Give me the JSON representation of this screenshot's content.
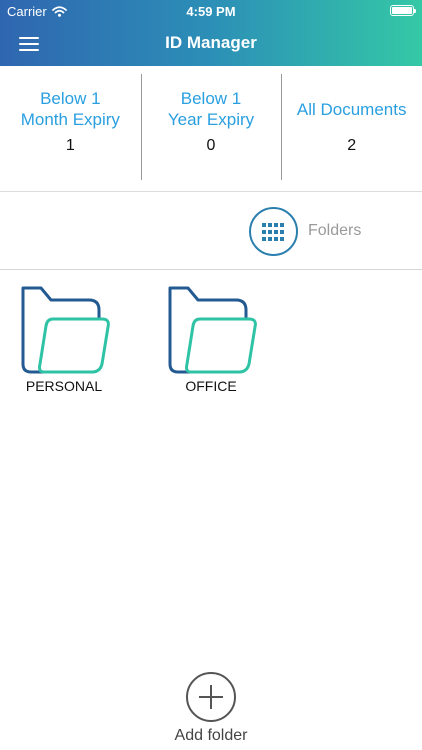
{
  "status_bar": {
    "carrier": "Carrier",
    "time": "4:59 PM"
  },
  "header": {
    "title": "ID Manager",
    "menu_icon": "hamburger-menu-icon"
  },
  "stats": [
    {
      "label_line1": "Below 1",
      "label_line2": "Month Expiry",
      "count": "1"
    },
    {
      "label_line1": "Below 1",
      "label_line2": "Year Expiry",
      "count": "0"
    },
    {
      "label": "All Documents",
      "count": "2"
    }
  ],
  "view_toggle": {
    "label": "Folders",
    "icon": "grid-icon"
  },
  "folders": [
    {
      "name": "PERSONAL",
      "icon": "folder-icon"
    },
    {
      "name": "OFFICE",
      "icon": "folder-icon"
    }
  ],
  "add_folder": {
    "label": "Add folder",
    "icon": "plus-icon"
  },
  "colors": {
    "header_gradient": [
      "#2f66b0",
      "#34c8a6"
    ],
    "stat_label": "#2a9fe0",
    "folder_back": "#235a91",
    "folder_front": "#2fc3a5"
  }
}
